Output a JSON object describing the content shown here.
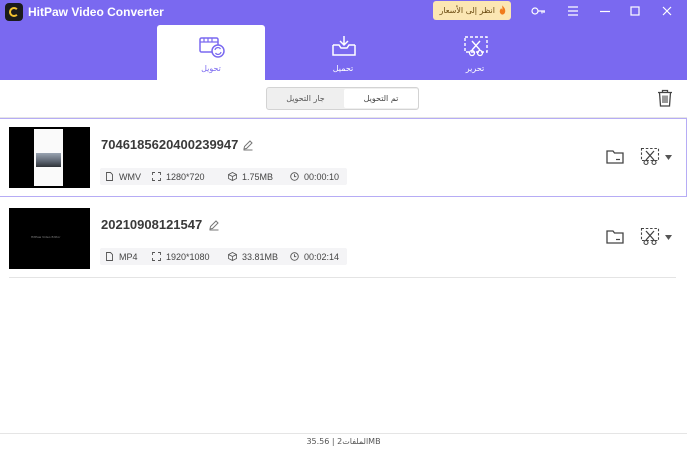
{
  "app": {
    "title": "HitPaw Video Converter"
  },
  "promo": {
    "label": "انظر إلى الأسعار"
  },
  "icons": {
    "key": "key-icon",
    "menu": "menu-icon",
    "minimize": "minimize-icon",
    "maximize": "maximize-icon",
    "close": "close-icon"
  },
  "tabs": [
    {
      "label": "تحويل",
      "icon": "convert-icon",
      "active": true
    },
    {
      "label": "تحميل",
      "icon": "download-icon",
      "active": false
    },
    {
      "label": "تحرير",
      "icon": "edit-toolbox-icon",
      "active": false
    }
  ],
  "segment": {
    "converting": "جار التحويل",
    "converted": "تم التحويل"
  },
  "files": [
    {
      "name": "7046185620400239947",
      "format": "WMV",
      "resolution": "1280*720",
      "size": "1.75MB",
      "duration": "00:00:10"
    },
    {
      "name": "20210908121547",
      "format": "MP4",
      "resolution": "1920*1080",
      "size": "33.81MB",
      "duration": "00:02:14"
    }
  ],
  "thumb2_text": "HitPaw Video Editor",
  "status": {
    "text": "الملفات2 | 35.56MB"
  },
  "colors": {
    "accent": "#7a69f0",
    "highlight_border": "#b6acf5"
  }
}
